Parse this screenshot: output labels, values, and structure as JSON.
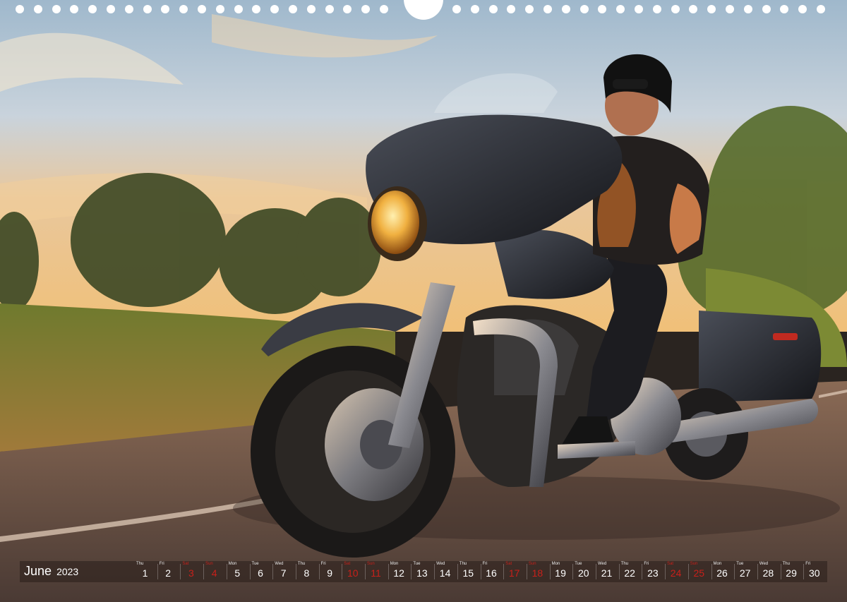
{
  "calendar": {
    "month": "June",
    "year": "2023",
    "days": [
      {
        "wd": "Thu",
        "d": "1",
        "we": false
      },
      {
        "wd": "Fri",
        "d": "2",
        "we": false
      },
      {
        "wd": "Sat",
        "d": "3",
        "we": true
      },
      {
        "wd": "Sun",
        "d": "4",
        "we": true
      },
      {
        "wd": "Mon",
        "d": "5",
        "we": false
      },
      {
        "wd": "Tue",
        "d": "6",
        "we": false
      },
      {
        "wd": "Wed",
        "d": "7",
        "we": false
      },
      {
        "wd": "Thu",
        "d": "8",
        "we": false
      },
      {
        "wd": "Fri",
        "d": "9",
        "we": false
      },
      {
        "wd": "Sat",
        "d": "10",
        "we": true
      },
      {
        "wd": "Sun",
        "d": "11",
        "we": true
      },
      {
        "wd": "Mon",
        "d": "12",
        "we": false
      },
      {
        "wd": "Tue",
        "d": "13",
        "we": false
      },
      {
        "wd": "Wed",
        "d": "14",
        "we": false
      },
      {
        "wd": "Thu",
        "d": "15",
        "we": false
      },
      {
        "wd": "Fri",
        "d": "16",
        "we": false
      },
      {
        "wd": "Sat",
        "d": "17",
        "we": true
      },
      {
        "wd": "Sun",
        "d": "18",
        "we": true
      },
      {
        "wd": "Mon",
        "d": "19",
        "we": false
      },
      {
        "wd": "Tue",
        "d": "20",
        "we": false
      },
      {
        "wd": "Wed",
        "d": "21",
        "we": false
      },
      {
        "wd": "Thu",
        "d": "22",
        "we": false
      },
      {
        "wd": "Fri",
        "d": "23",
        "we": false
      },
      {
        "wd": "Sat",
        "d": "24",
        "we": true
      },
      {
        "wd": "Sun",
        "d": "25",
        "we": true
      },
      {
        "wd": "Mon",
        "d": "26",
        "we": false
      },
      {
        "wd": "Tue",
        "d": "27",
        "we": false
      },
      {
        "wd": "Wed",
        "d": "28",
        "we": false
      },
      {
        "wd": "Thu",
        "d": "29",
        "we": false
      },
      {
        "wd": "Fri",
        "d": "30",
        "we": false
      }
    ],
    "weekend_color": "#c8201a"
  },
  "photo": {
    "subject": "motorcycle-rider",
    "sky_color": "#b9c9d6",
    "sunset_color": "#e8b070",
    "foliage_color": "#6f7a2e",
    "road_color": "#6b5144"
  }
}
